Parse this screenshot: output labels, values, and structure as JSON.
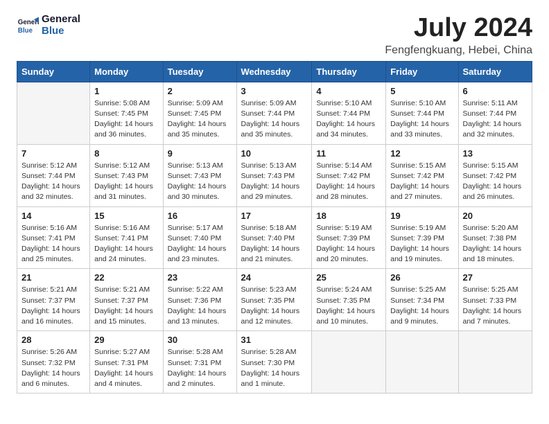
{
  "header": {
    "logo_line1": "General",
    "logo_line2": "Blue",
    "main_title": "July 2024",
    "subtitle": "Fengfengkuang, Hebei, China"
  },
  "columns": [
    "Sunday",
    "Monday",
    "Tuesday",
    "Wednesday",
    "Thursday",
    "Friday",
    "Saturday"
  ],
  "weeks": [
    [
      {
        "day": "",
        "info": ""
      },
      {
        "day": "1",
        "info": "Sunrise: 5:08 AM\nSunset: 7:45 PM\nDaylight: 14 hours\nand 36 minutes."
      },
      {
        "day": "2",
        "info": "Sunrise: 5:09 AM\nSunset: 7:45 PM\nDaylight: 14 hours\nand 35 minutes."
      },
      {
        "day": "3",
        "info": "Sunrise: 5:09 AM\nSunset: 7:44 PM\nDaylight: 14 hours\nand 35 minutes."
      },
      {
        "day": "4",
        "info": "Sunrise: 5:10 AM\nSunset: 7:44 PM\nDaylight: 14 hours\nand 34 minutes."
      },
      {
        "day": "5",
        "info": "Sunrise: 5:10 AM\nSunset: 7:44 PM\nDaylight: 14 hours\nand 33 minutes."
      },
      {
        "day": "6",
        "info": "Sunrise: 5:11 AM\nSunset: 7:44 PM\nDaylight: 14 hours\nand 32 minutes."
      }
    ],
    [
      {
        "day": "7",
        "info": "Sunrise: 5:12 AM\nSunset: 7:44 PM\nDaylight: 14 hours\nand 32 minutes."
      },
      {
        "day": "8",
        "info": "Sunrise: 5:12 AM\nSunset: 7:43 PM\nDaylight: 14 hours\nand 31 minutes."
      },
      {
        "day": "9",
        "info": "Sunrise: 5:13 AM\nSunset: 7:43 PM\nDaylight: 14 hours\nand 30 minutes."
      },
      {
        "day": "10",
        "info": "Sunrise: 5:13 AM\nSunset: 7:43 PM\nDaylight: 14 hours\nand 29 minutes."
      },
      {
        "day": "11",
        "info": "Sunrise: 5:14 AM\nSunset: 7:42 PM\nDaylight: 14 hours\nand 28 minutes."
      },
      {
        "day": "12",
        "info": "Sunrise: 5:15 AM\nSunset: 7:42 PM\nDaylight: 14 hours\nand 27 minutes."
      },
      {
        "day": "13",
        "info": "Sunrise: 5:15 AM\nSunset: 7:42 PM\nDaylight: 14 hours\nand 26 minutes."
      }
    ],
    [
      {
        "day": "14",
        "info": "Sunrise: 5:16 AM\nSunset: 7:41 PM\nDaylight: 14 hours\nand 25 minutes."
      },
      {
        "day": "15",
        "info": "Sunrise: 5:16 AM\nSunset: 7:41 PM\nDaylight: 14 hours\nand 24 minutes."
      },
      {
        "day": "16",
        "info": "Sunrise: 5:17 AM\nSunset: 7:40 PM\nDaylight: 14 hours\nand 23 minutes."
      },
      {
        "day": "17",
        "info": "Sunrise: 5:18 AM\nSunset: 7:40 PM\nDaylight: 14 hours\nand 21 minutes."
      },
      {
        "day": "18",
        "info": "Sunrise: 5:19 AM\nSunset: 7:39 PM\nDaylight: 14 hours\nand 20 minutes."
      },
      {
        "day": "19",
        "info": "Sunrise: 5:19 AM\nSunset: 7:39 PM\nDaylight: 14 hours\nand 19 minutes."
      },
      {
        "day": "20",
        "info": "Sunrise: 5:20 AM\nSunset: 7:38 PM\nDaylight: 14 hours\nand 18 minutes."
      }
    ],
    [
      {
        "day": "21",
        "info": "Sunrise: 5:21 AM\nSunset: 7:37 PM\nDaylight: 14 hours\nand 16 minutes."
      },
      {
        "day": "22",
        "info": "Sunrise: 5:21 AM\nSunset: 7:37 PM\nDaylight: 14 hours\nand 15 minutes."
      },
      {
        "day": "23",
        "info": "Sunrise: 5:22 AM\nSunset: 7:36 PM\nDaylight: 14 hours\nand 13 minutes."
      },
      {
        "day": "24",
        "info": "Sunrise: 5:23 AM\nSunset: 7:35 PM\nDaylight: 14 hours\nand 12 minutes."
      },
      {
        "day": "25",
        "info": "Sunrise: 5:24 AM\nSunset: 7:35 PM\nDaylight: 14 hours\nand 10 minutes."
      },
      {
        "day": "26",
        "info": "Sunrise: 5:25 AM\nSunset: 7:34 PM\nDaylight: 14 hours\nand 9 minutes."
      },
      {
        "day": "27",
        "info": "Sunrise: 5:25 AM\nSunset: 7:33 PM\nDaylight: 14 hours\nand 7 minutes."
      }
    ],
    [
      {
        "day": "28",
        "info": "Sunrise: 5:26 AM\nSunset: 7:32 PM\nDaylight: 14 hours\nand 6 minutes."
      },
      {
        "day": "29",
        "info": "Sunrise: 5:27 AM\nSunset: 7:31 PM\nDaylight: 14 hours\nand 4 minutes."
      },
      {
        "day": "30",
        "info": "Sunrise: 5:28 AM\nSunset: 7:31 PM\nDaylight: 14 hours\nand 2 minutes."
      },
      {
        "day": "31",
        "info": "Sunrise: 5:28 AM\nSunset: 7:30 PM\nDaylight: 14 hours\nand 1 minute."
      },
      {
        "day": "",
        "info": ""
      },
      {
        "day": "",
        "info": ""
      },
      {
        "day": "",
        "info": ""
      }
    ]
  ]
}
